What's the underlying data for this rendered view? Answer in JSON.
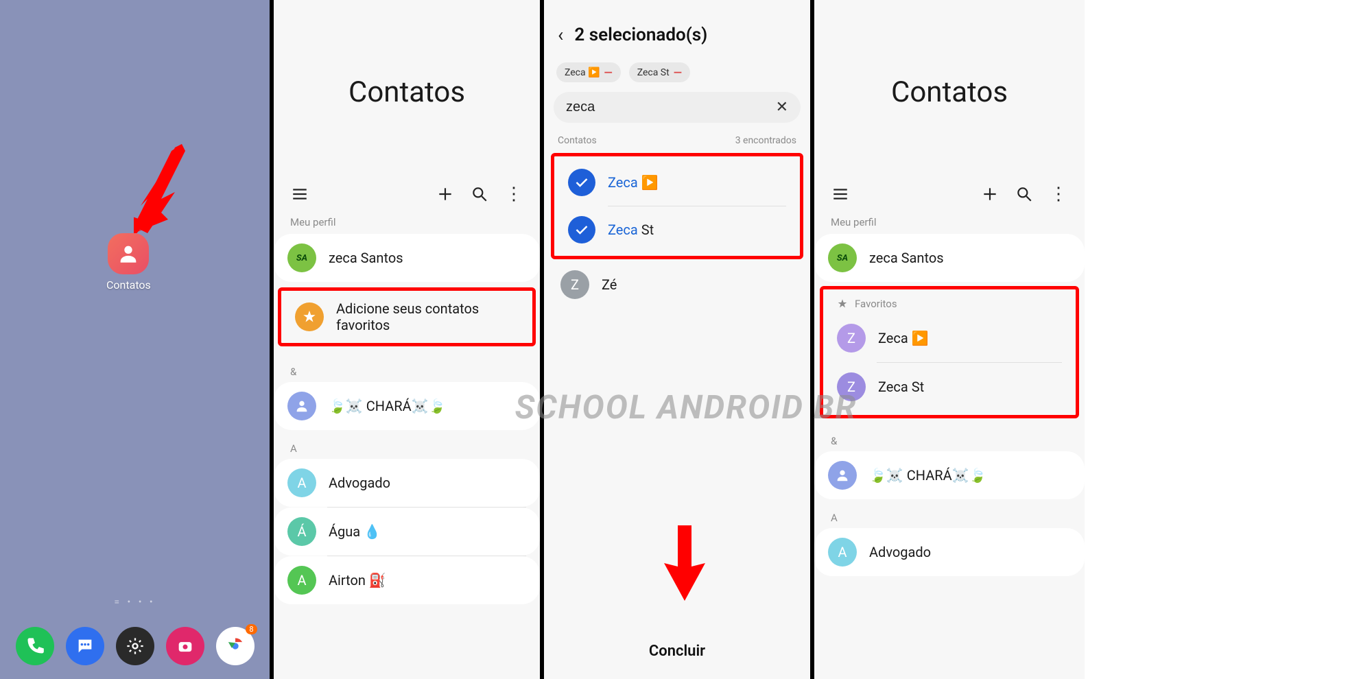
{
  "watermark": "SCHOOL ANDROID BR",
  "panel1": {
    "app_label": "Contatos",
    "dock_badge": "8",
    "page_dots": "=  •  •  •"
  },
  "panel2": {
    "title": "Contatos",
    "section_profile": "Meu perfil",
    "profile_name": "zeca Santos",
    "add_fav_label": "Adicione seus contatos favoritos",
    "group_amp": "&",
    "contact_amp": "🍃☠️ CHARÁ☠️🍃",
    "group_a": "A",
    "contacts_a": {
      "c0": "Advogado",
      "c1": "Água 💧",
      "c2": "Airton ⛽"
    }
  },
  "panel3": {
    "header": "2 selecionado(s)",
    "chips": {
      "c0": "Zeca ▶️",
      "c1": "Zeca St"
    },
    "search_value": "zeca",
    "found_label": "Contatos",
    "found_count": "3 encontrados",
    "results": {
      "r0_match": "Zeca",
      "r0_rest": " ▶️",
      "r1_match": "Zeca",
      "r1_rest": " St",
      "r2": "Zé"
    },
    "done": "Concluir"
  },
  "panel4": {
    "title": "Contatos",
    "section_profile": "Meu perfil",
    "profile_name": "zeca Santos",
    "fav_label": "Favoritos",
    "favs": {
      "f0": "Zeca ▶️",
      "f1": "Zeca St"
    },
    "group_amp": "&",
    "contact_amp": "🍃☠️ CHARÁ☠️🍃",
    "group_a": "A",
    "contacts_a": {
      "c0": "Advogado"
    }
  }
}
